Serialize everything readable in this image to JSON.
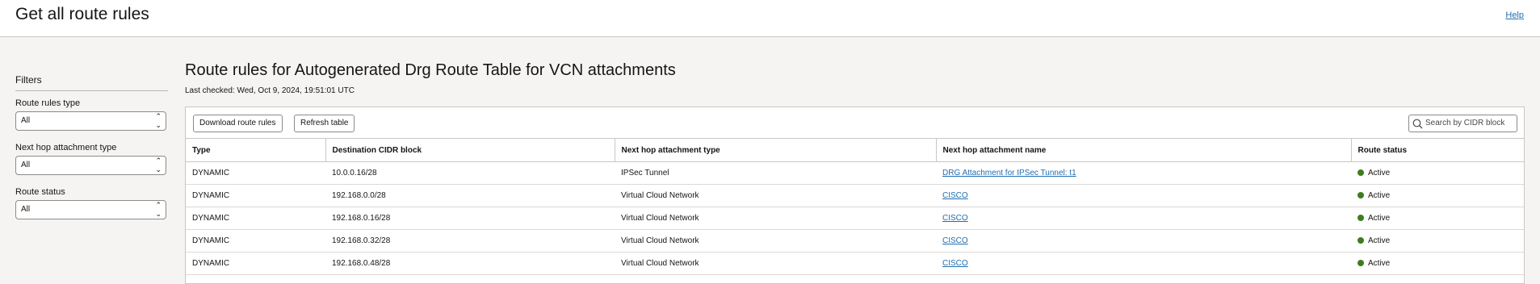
{
  "header": {
    "title": "Get all route rules",
    "help_label": "Help"
  },
  "filters": {
    "title": "Filters",
    "route_rules_type": {
      "label": "Route rules type",
      "value": "All"
    },
    "next_hop_type": {
      "label": "Next hop attachment type",
      "value": "All"
    },
    "route_status": {
      "label": "Route status",
      "value": "All"
    }
  },
  "main": {
    "title": "Route rules for Autogenerated Drg Route Table for VCN attachments",
    "last_checked": "Last checked: Wed, Oct 9, 2024, 19:51:01 UTC",
    "download_label": "Download route rules",
    "refresh_label": "Refresh table",
    "search_placeholder": "Search by CIDR block"
  },
  "table": {
    "columns": [
      "Type",
      "Destination CIDR block",
      "Next hop attachment type",
      "Next hop attachment name",
      "Route status"
    ],
    "rows": [
      [
        "DYNAMIC",
        "10.0.0.16/28",
        "IPSec Tunnel",
        "DRG Attachment for IPSec Tunnel: t1",
        "Active"
      ],
      [
        "DYNAMIC",
        "192.168.0.0/28",
        "Virtual Cloud Network",
        "CISCO",
        "Active"
      ],
      [
        "DYNAMIC",
        "192.168.0.16/28",
        "Virtual Cloud Network",
        "CISCO",
        "Active"
      ],
      [
        "DYNAMIC",
        "192.168.0.32/28",
        "Virtual Cloud Network",
        "CISCO",
        "Active"
      ],
      [
        "DYNAMIC",
        "192.168.0.48/28",
        "Virtual Cloud Network",
        "CISCO",
        "Active"
      ]
    ]
  },
  "colors": {
    "status_active": "#3e7d1f",
    "link": "#1f6db0"
  }
}
